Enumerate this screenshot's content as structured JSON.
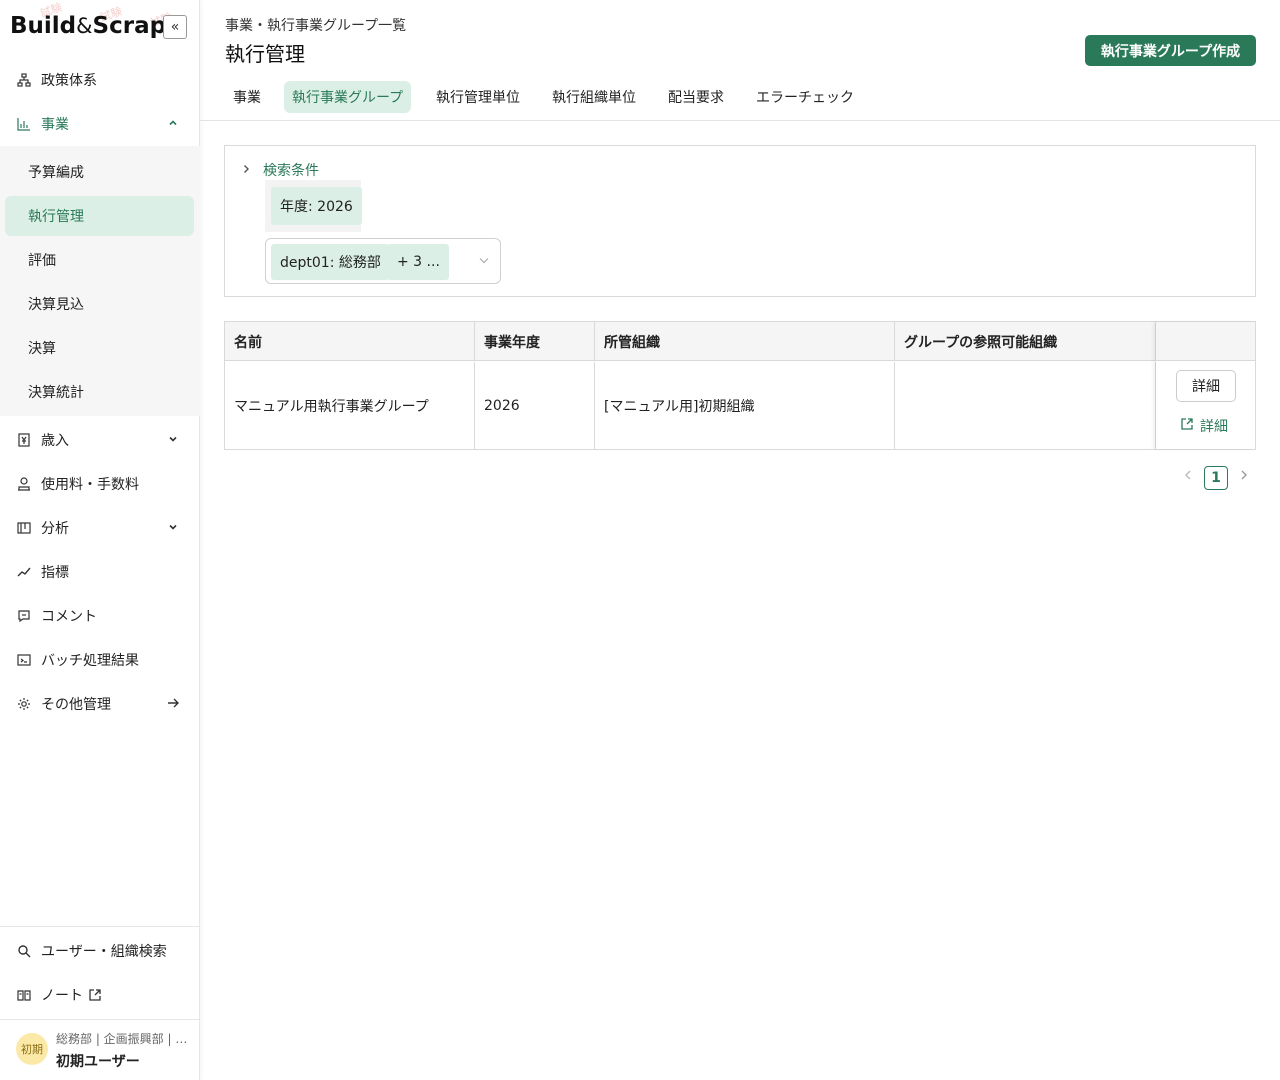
{
  "app": {
    "logo_left": "Build",
    "logo_amp": "&",
    "logo_right": "Scrap",
    "logo_stamp": "試験",
    "collapse_glyph": "«"
  },
  "sidebar": {
    "items": [
      {
        "label": "政策体系"
      },
      {
        "label": "事業"
      },
      {
        "label": "歳入"
      },
      {
        "label": "使用料・手数料"
      },
      {
        "label": "分析"
      },
      {
        "label": "指標"
      },
      {
        "label": "コメント"
      },
      {
        "label": "バッチ処理結果"
      },
      {
        "label": "その他管理"
      }
    ],
    "sub_items": [
      {
        "label": "予算編成"
      },
      {
        "label": "執行管理"
      },
      {
        "label": "評価"
      },
      {
        "label": "決算見込"
      },
      {
        "label": "決算"
      },
      {
        "label": "決算統計"
      }
    ],
    "bottom_items": [
      {
        "label": "ユーザー・組織検索"
      },
      {
        "label": "ノート"
      }
    ],
    "user": {
      "avatar": "初期",
      "org": "総務部 | 企画振興部 | …",
      "name": "初期ユーザー"
    }
  },
  "header": {
    "breadcrumb": "事業・執行事業グループ一覧",
    "title": "執行管理",
    "create_button": "執行事業グループ作成"
  },
  "tabs": [
    {
      "label": "事業"
    },
    {
      "label": "執行事業グループ"
    },
    {
      "label": "執行管理単位"
    },
    {
      "label": "執行組織単位"
    },
    {
      "label": "配当要求"
    },
    {
      "label": "エラーチェック"
    }
  ],
  "search": {
    "toggle_label": "検索条件",
    "year_chip": "年度: 2026",
    "org_chip": "dept01: 総務部",
    "more_chip": "+ 3 ..."
  },
  "table": {
    "headers": [
      "名前",
      "事業年度",
      "所管組織",
      "グループの参照可能組織"
    ],
    "rows": [
      {
        "name": "マニュアル用執行事業グループ",
        "year": "2026",
        "org": "[マニュアル用]初期組織",
        "ref_org": ""
      }
    ],
    "detail_button": "詳細",
    "detail_link": "詳細"
  },
  "pagination": {
    "current": "1"
  },
  "colors": {
    "accent": "#2a7a5a",
    "accent_light": "#dcefe6"
  }
}
